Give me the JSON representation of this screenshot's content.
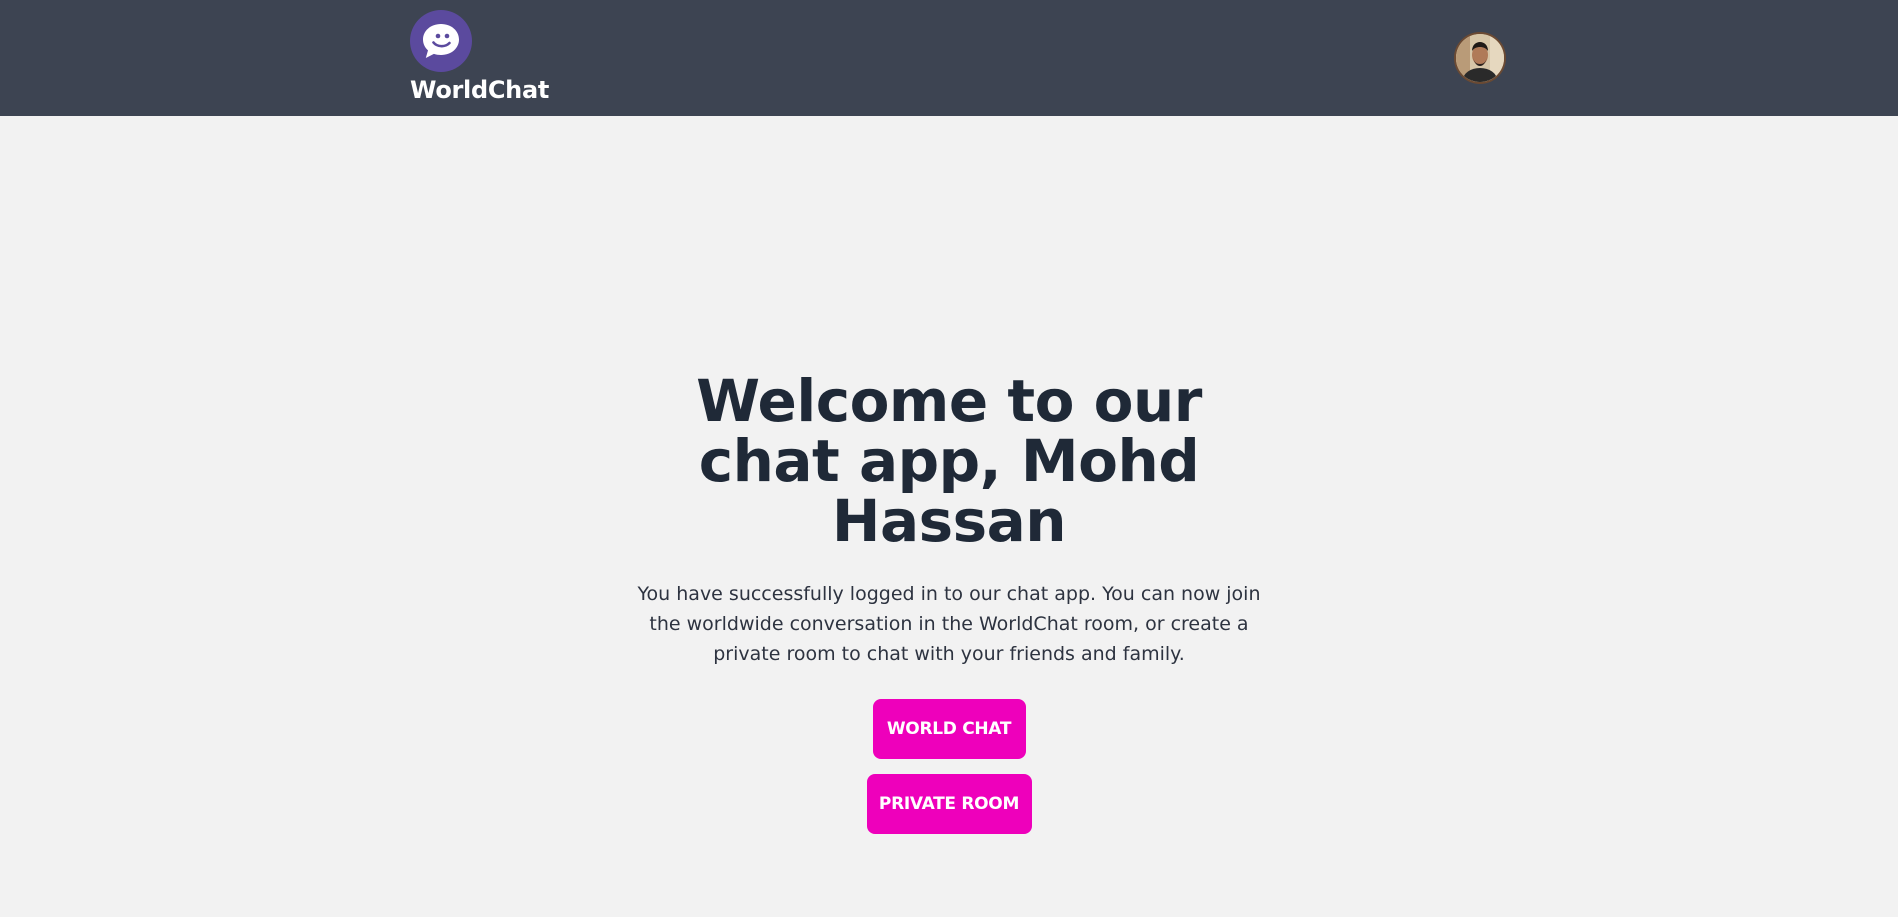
{
  "colors": {
    "navbar_bg": "#3d4452",
    "page_bg": "#f2f2f2",
    "accent_button": "#ee00bb",
    "logo_bg": "#5b4a9e",
    "heading_text": "#1f2937"
  },
  "navbar": {
    "logo_icon": "smiling-chat-bubble-icon",
    "brand_name": "WorldChat",
    "avatar_icon": "user-avatar-photo"
  },
  "hero": {
    "headline": "Welcome to our chat app, Mohd Hassan",
    "description": "You have successfully logged in to our chat app. You can now join the worldwide conversation in the WorldChat room, or create a private room to chat with your friends and family.",
    "world_chat_label": "WORLD CHAT",
    "private_room_label": "PRIVATE ROOM"
  }
}
